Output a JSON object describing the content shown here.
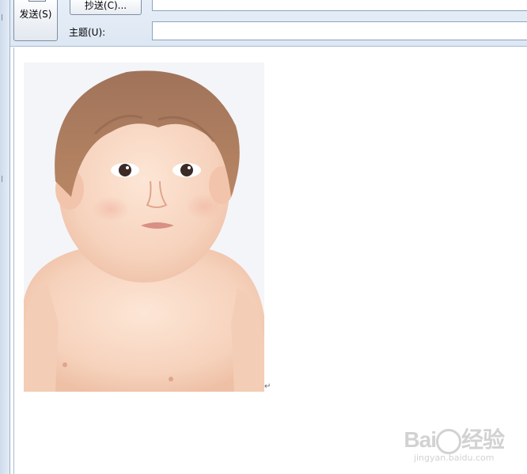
{
  "toolbar": {
    "send_label": "发送(S)",
    "cc_label": "抄送(C)..."
  },
  "fields": {
    "subject_label": "主题(U):",
    "subject_value": "",
    "cc_value": ""
  },
  "body": {
    "paragraph_mark": "↵"
  },
  "watermark": {
    "brand_left": "Bai",
    "brand_right": "经验",
    "url": "jingyan.baidu.com"
  }
}
